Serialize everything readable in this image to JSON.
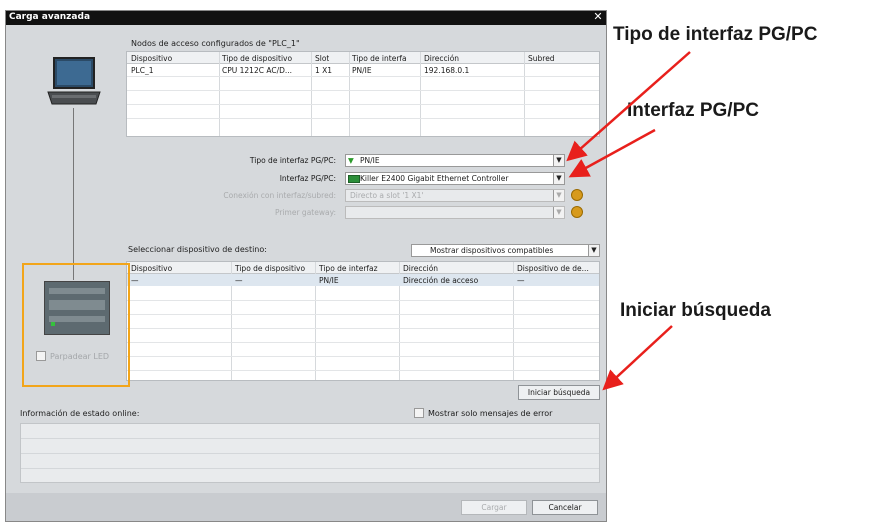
{
  "window": {
    "title": "Carga avanzada",
    "close_glyph": "✕"
  },
  "access_nodes": {
    "title": "Nodos de acceso configurados de \"PLC_1\"",
    "columns": [
      "Dispositivo",
      "Tipo de dispositivo",
      "Slot",
      "Tipo de interfa",
      "Dirección",
      "Subred"
    ],
    "rows": [
      [
        "PLC_1",
        "CPU 1212C AC/D...",
        "1 X1",
        "PN/IE",
        "192.168.0.1",
        ""
      ]
    ]
  },
  "interface_settings": {
    "type_label": "Tipo de interfaz PG/PC:",
    "type_value": "PN/IE",
    "iface_label": "Interfaz PG/PC:",
    "iface_value": "Killer E2400 Gigabit Ethernet Controller",
    "subnet_label": "Conexión con interfaz/subred:",
    "subnet_value": "Directo a slot '1 X1'",
    "gateway_label": "Primer gateway:",
    "gateway_value": ""
  },
  "target": {
    "title": "Seleccionar dispositivo de destino:",
    "filter_value": "Mostrar dispositivos compatibles",
    "columns": [
      "Dispositivo",
      "Tipo de dispositivo",
      "Tipo de interfaz",
      "Dirección",
      "Dispositivo de de..."
    ],
    "rows": [
      [
        "—",
        "—",
        "PN/IE",
        "Dirección de acceso",
        "—"
      ]
    ]
  },
  "led_checkbox_label": "Parpadear LED",
  "start_search_label": "Iniciar búsqueda",
  "status": {
    "title": "Información de estado online:",
    "errors_only_label": "Mostrar solo mensajes de error"
  },
  "footer": {
    "load_label": "Cargar",
    "cancel_label": "Cancelar"
  },
  "annotations": {
    "iface_type": "Tipo de interfaz PG/PC",
    "iface": "Interfaz PG/PC",
    "search": "Iniciar búsqueda"
  },
  "colors": {
    "accent_orange": "#f2a51a",
    "arrow_red": "#e8201c",
    "title_bar": "#111111"
  }
}
